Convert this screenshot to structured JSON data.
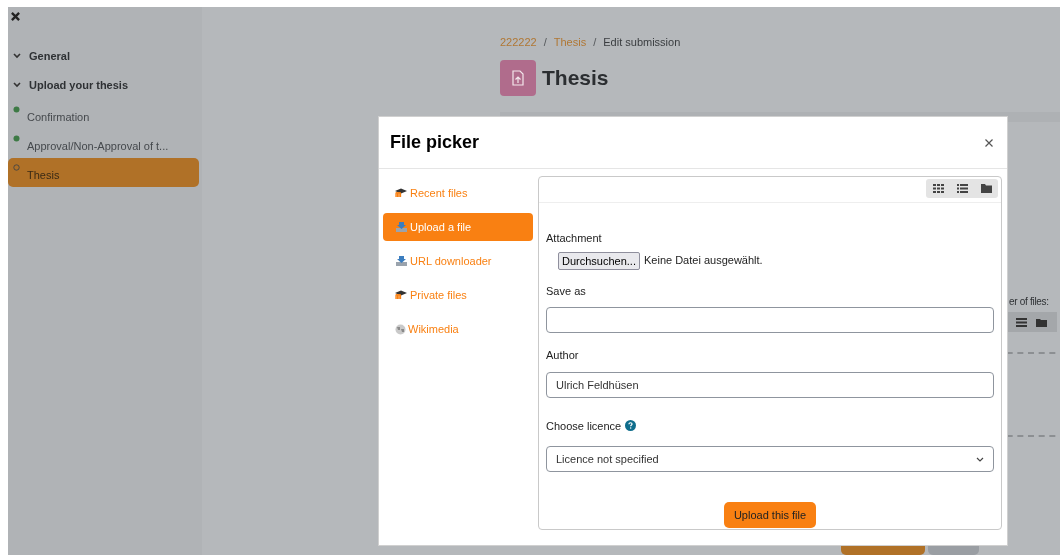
{
  "drawer": {
    "sections": [
      {
        "label": "General",
        "expanded": true
      },
      {
        "label": "Upload your thesis",
        "expanded": true,
        "children": [
          {
            "label": "Confirmation",
            "completed": true,
            "selected": false
          },
          {
            "label": "Approval/Non-Approval of t...",
            "completed": true,
            "selected": false
          },
          {
            "label": "Thesis",
            "completed": false,
            "selected": true
          }
        ]
      }
    ]
  },
  "breadcrumb": [
    {
      "kind": "link",
      "label": "222222"
    },
    {
      "kind": "separator",
      "label": "/"
    },
    {
      "kind": "link",
      "label": "Thesis"
    },
    {
      "kind": "separator",
      "label": "/"
    },
    {
      "kind": "current",
      "label": "Edit submission"
    }
  ],
  "page_title": "Thesis",
  "background_label": "er of files:",
  "file_picker": {
    "title": "File picker",
    "repositories": [
      {
        "label": "Recent files",
        "kind": "moodle",
        "selected": false
      },
      {
        "label": "Upload a file",
        "kind": "upload",
        "selected": true
      },
      {
        "label": "URL downloader",
        "kind": "upload",
        "selected": false
      },
      {
        "label": "Private files",
        "kind": "moodle",
        "selected": false
      },
      {
        "label": "Wikimedia",
        "kind": "globe",
        "selected": false
      }
    ],
    "form": {
      "attachment_label": "Attachment",
      "browse_button": "Durchsuchen...",
      "file_status": "Keine Datei ausgewählt.",
      "save_as_label": "Save as",
      "author_label": "Author",
      "author_value": "Ulrich Feldhüsen",
      "licence_label": "Choose licence",
      "licence_value": "Licence not specified",
      "submit_button": "Upload this file"
    }
  }
}
